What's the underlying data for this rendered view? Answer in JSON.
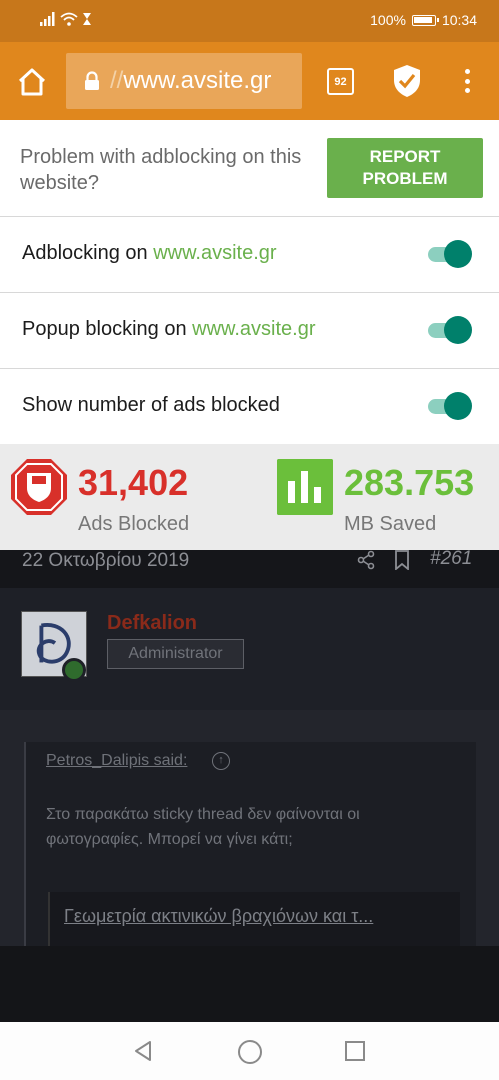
{
  "status_bar": {
    "battery": "100%",
    "time": "10:34",
    "icons": [
      "signal-icon",
      "wifi-icon",
      "hourglass-icon",
      "battery-icon"
    ]
  },
  "toolbar": {
    "url_prefix": "//",
    "url_host": "www.avsite.gr",
    "tab_count": "92",
    "accent": "#e0871d"
  },
  "panel": {
    "report_text": "Problem with adblocking on this website?",
    "report_button": "REPORT PROBLEM",
    "toggles": [
      {
        "label": "Adblocking on ",
        "domain": "www.avsite.gr",
        "on": true
      },
      {
        "label": "Popup blocking on ",
        "domain": "www.avsite.gr",
        "on": true
      },
      {
        "label": "Show number of ads blocked",
        "domain": "",
        "on": true
      }
    ],
    "stats": {
      "ads_value": "31,402",
      "ads_label": "Ads Blocked",
      "mb_value": "283.753",
      "mb_label": "MB Saved"
    },
    "colors": {
      "green": "#6ab04c",
      "red": "#d8302a",
      "teal": "#00806b"
    }
  },
  "page": {
    "post_date": "22 Οκτωβρίου 2019",
    "post_number": "#261",
    "username": "Defkalion",
    "role": "Administrator",
    "quote_author": "Petros_Dalipis said:",
    "quote_arrow": "↑",
    "quote_text": "Στο παρακάτω sticky thread δεν φαίνονται οι φωτογραφίες. Μπορεί να γίνει κάτι;",
    "link_text": "Γεωμετρία ακτινικών βραχιόνων και τ..."
  }
}
